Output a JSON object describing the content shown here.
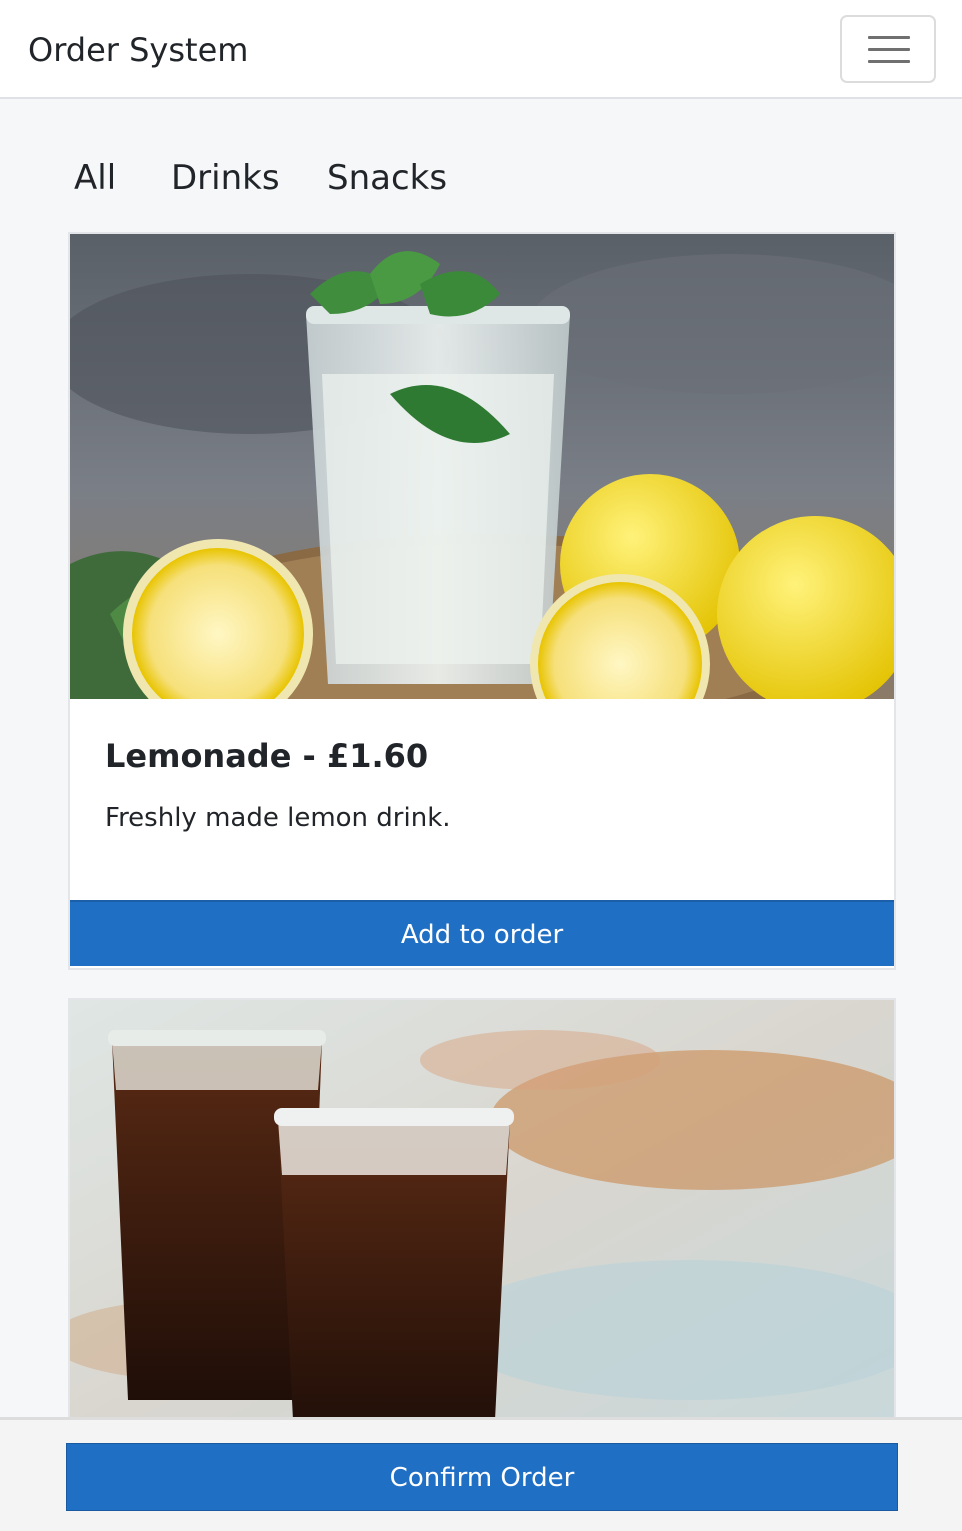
{
  "app": {
    "brand": "Order System"
  },
  "tabs": [
    {
      "label": "All"
    },
    {
      "label": "Drinks"
    },
    {
      "label": "Snacks"
    }
  ],
  "products": [
    {
      "title": "Lemonade - £1.60",
      "description": "Freshly made lemon drink.",
      "button_label": "Add to order"
    },
    {}
  ],
  "footer": {
    "confirm_label": "Confirm Order"
  },
  "colors": {
    "primary": "#1f6fc5",
    "page_background": "#f6f7f9"
  }
}
